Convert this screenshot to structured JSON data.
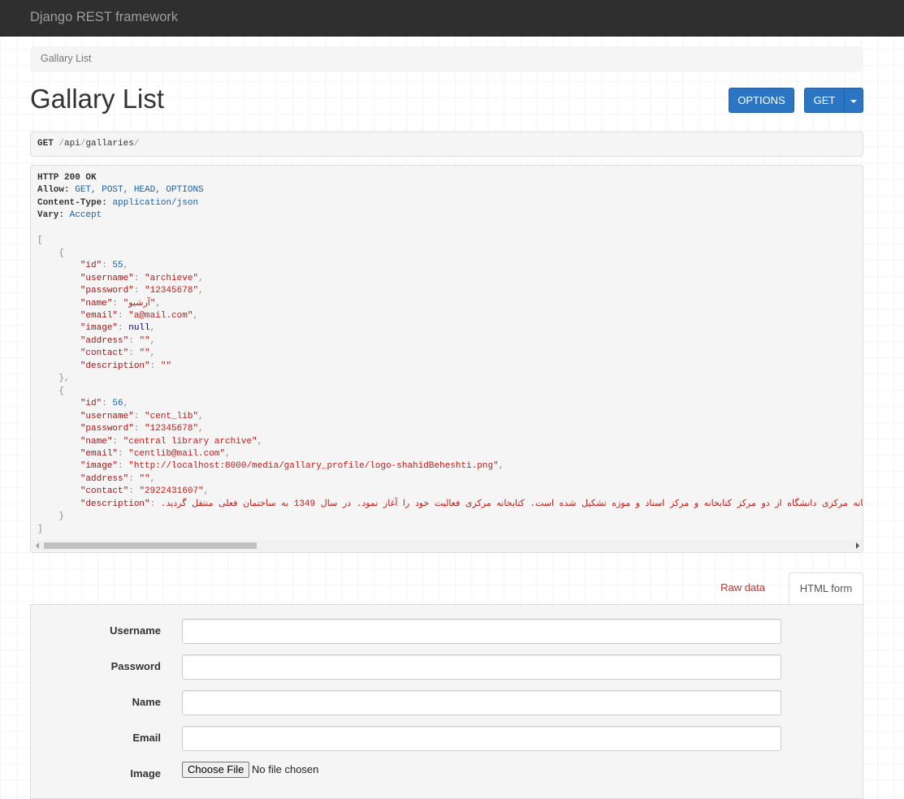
{
  "navbar": {
    "brand": "Django REST framework"
  },
  "breadcrumb": {
    "current": "Gallary List"
  },
  "page": {
    "title": "Gallary List"
  },
  "buttons": {
    "options": "OPTIONS",
    "get": "GET"
  },
  "request": {
    "method": "GET",
    "path_parts": [
      "api",
      "gallaries"
    ]
  },
  "response": {
    "status": "HTTP 200 OK",
    "headers": [
      {
        "name": "Allow:",
        "value": "GET, POST, HEAD, OPTIONS"
      },
      {
        "name": "Content-Type:",
        "value": "application/json"
      },
      {
        "name": "Vary:",
        "value": "Accept"
      }
    ],
    "records": [
      {
        "id": "55",
        "username": "\"archieve\"",
        "password": "\"12345678\"",
        "name": "\"آرشیو\"",
        "email": "\"a@mail.com\"",
        "image": "null",
        "address": "\"\"",
        "contact": "\"\"",
        "description": "\"\""
      },
      {
        "id": "56",
        "username": "\"cent_lib\"",
        "password": "\"12345678\"",
        "name": "\"central library archive\"",
        "email": "\"centlib@mail.com\"",
        "image": "\"http://localhost:8000/media/gallary_profile/logo-shahidBeheshti.png\"",
        "address": "\"\"",
        "contact": "\"2922431607\"",
        "description": "\"کتابخانه مرکزی دانشگاه از دو مرکز کتابخانه و مرکز اسناد و موزه تشکیل شده است. کتابخانه مرکزی فعالیت خود را آغاز نمود. در سال 1349 به ساختمان فعلی منتقل گردید."
      }
    ]
  },
  "tabs": {
    "raw": "Raw data",
    "html": "HTML form"
  },
  "form": {
    "fields": [
      {
        "label": "Username"
      },
      {
        "label": "Password"
      },
      {
        "label": "Name"
      },
      {
        "label": "Email"
      }
    ],
    "image": {
      "label": "Image",
      "button": "Choose File",
      "status": "No file chosen"
    }
  }
}
